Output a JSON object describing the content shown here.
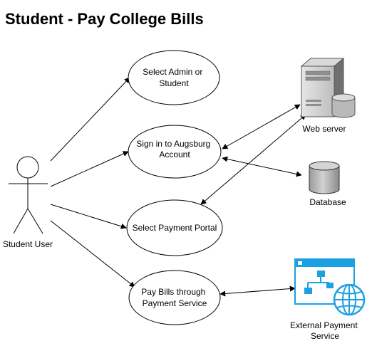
{
  "title": "Student - Pay College Bills",
  "actor": {
    "label": "Student User"
  },
  "use_cases": [
    {
      "id": "select-admin",
      "lines": [
        "Select Admin or",
        "Student"
      ]
    },
    {
      "id": "sign-in",
      "lines": [
        "Sign in to Augsburg",
        "Account"
      ]
    },
    {
      "id": "payment-portal",
      "lines": [
        "Select Payment Portal"
      ]
    },
    {
      "id": "pay-bills",
      "lines": [
        "Pay Bills through",
        "Payment Service"
      ]
    }
  ],
  "systems": {
    "web_server": {
      "label": "Web server",
      "icon": "server-icon"
    },
    "database": {
      "label": "Database",
      "icon": "database-icon"
    },
    "external_service": {
      "lines": [
        "External Payment",
        "Service"
      ],
      "icon": "web-service-icon"
    }
  },
  "colors": {
    "stroke": "#000000",
    "server_body": "#8d8d8d",
    "database_fill": "#c4c4c4",
    "service_blue": "#1ba1e2"
  }
}
